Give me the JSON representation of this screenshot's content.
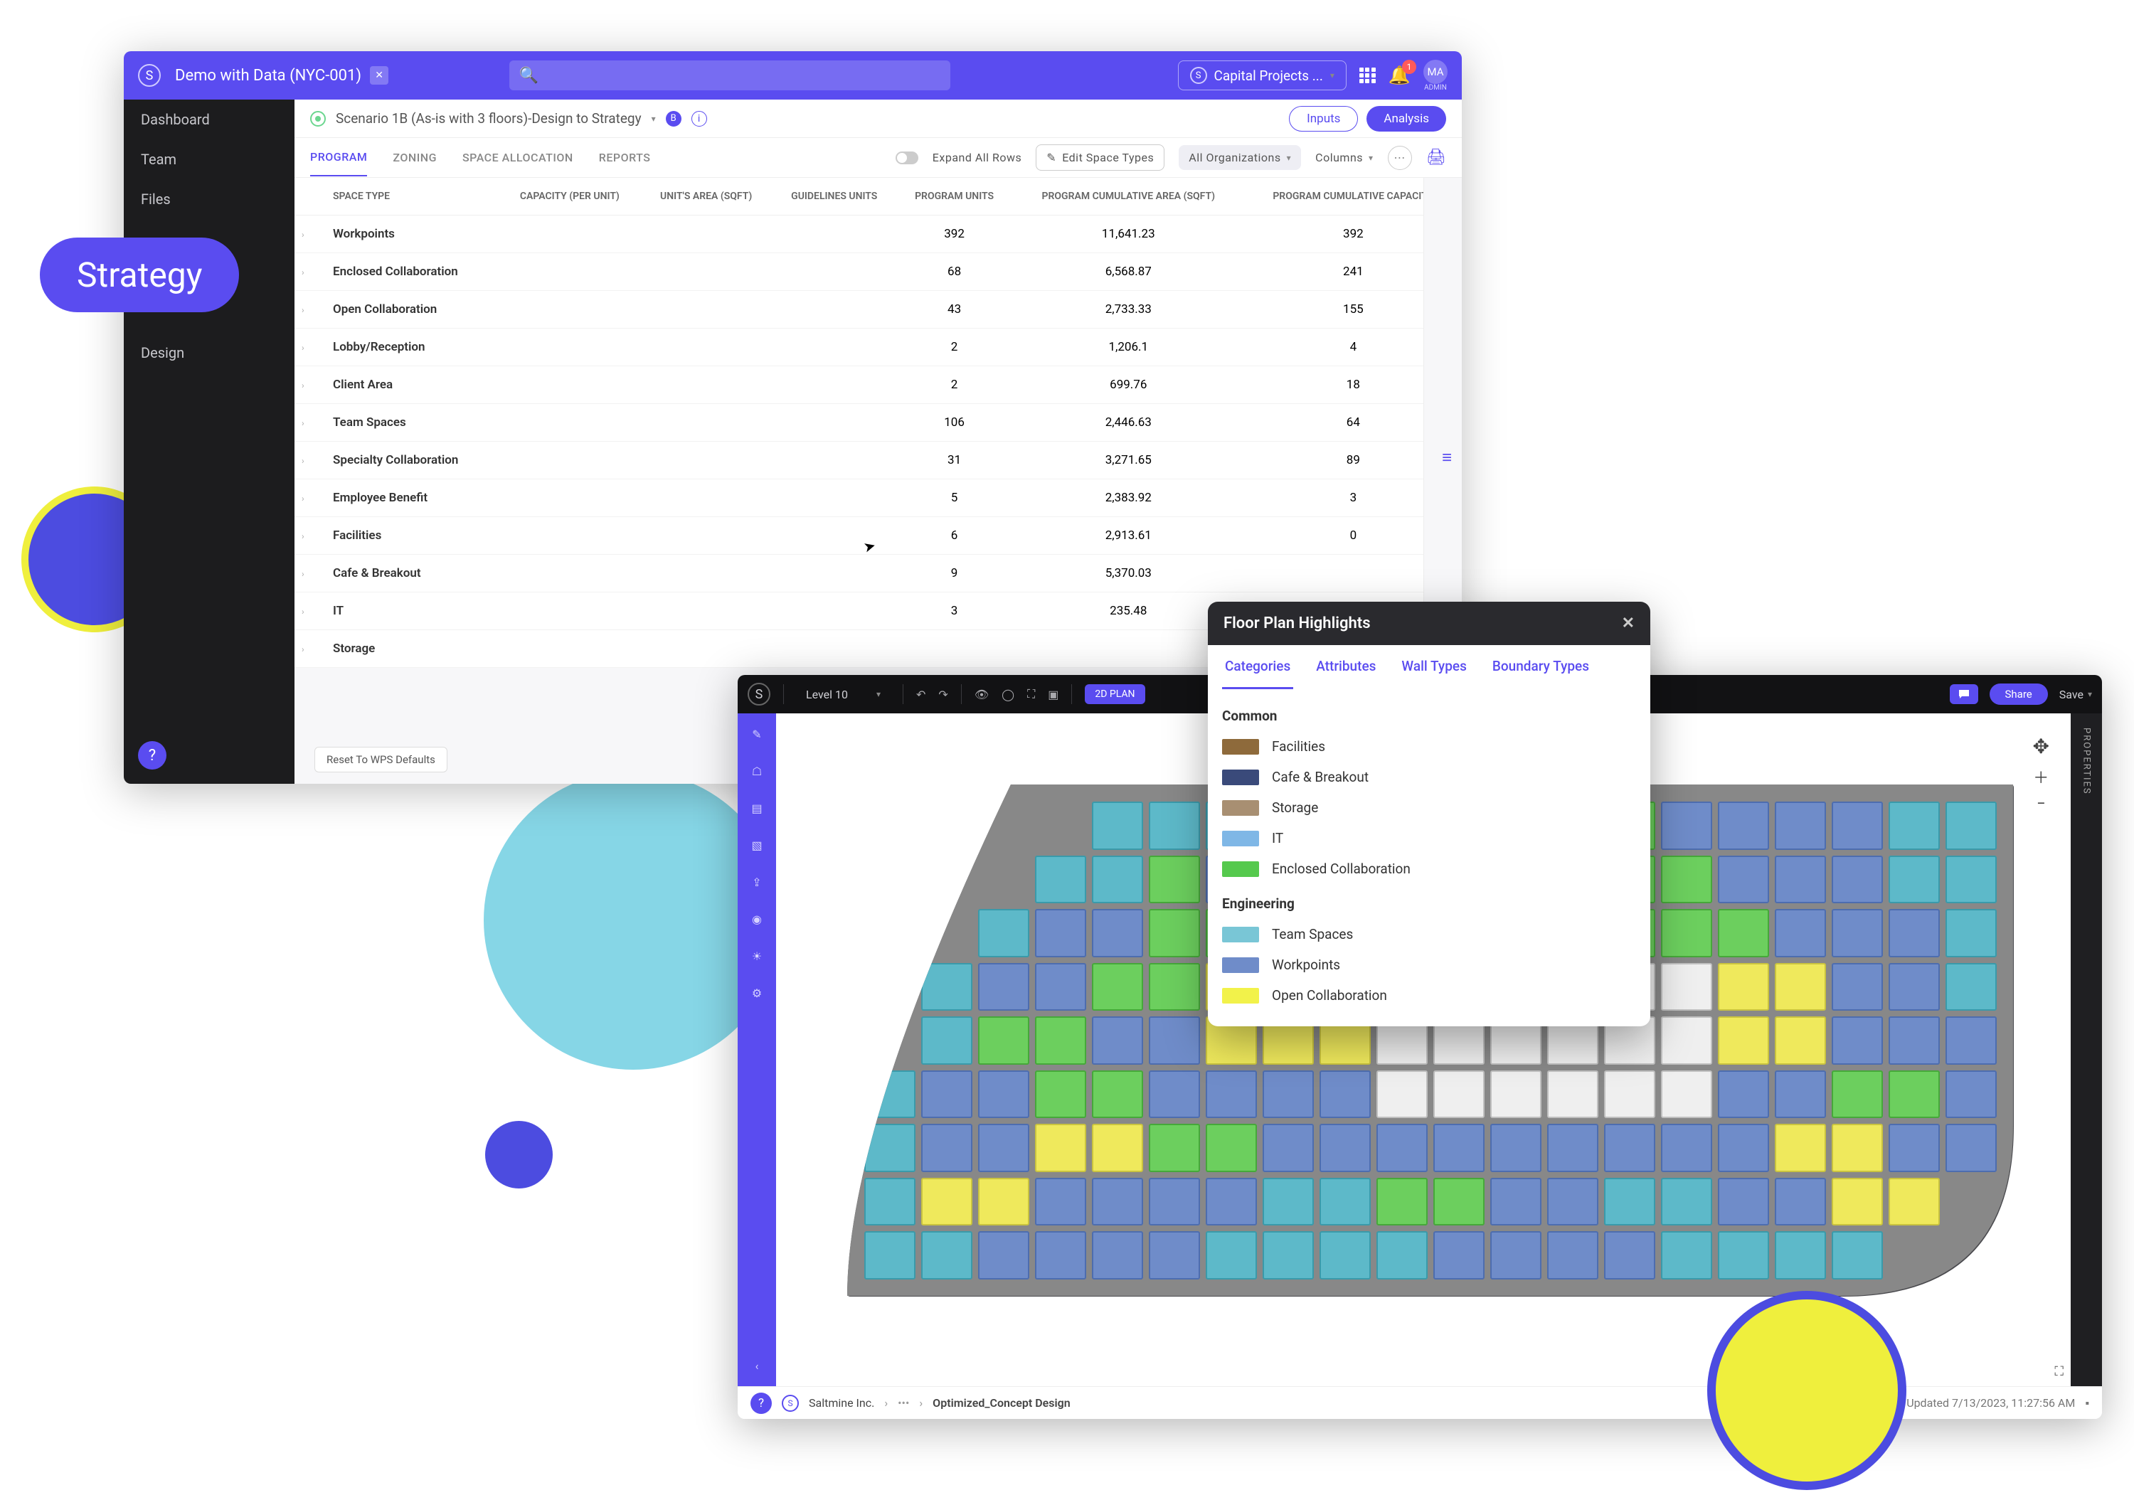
{
  "decor": {
    "strategy_pill": "Strategy"
  },
  "win1": {
    "title": "Demo with Data (NYC-001)",
    "search_placeholder": "",
    "org_selector": "Capital Projects ...",
    "notif_count": "1",
    "avatar": "MA",
    "admin_label": "ADMIN",
    "sidebar": [
      "Dashboard",
      "Team",
      "Files",
      "Design"
    ],
    "scenario": {
      "name": "Scenario 1B (As-is with 3 floors)-Design to Strategy",
      "badge": "B",
      "inputs_btn": "Inputs",
      "analysis_btn": "Analysis"
    },
    "tabs": [
      "PROGRAM",
      "ZONING",
      "SPACE ALLOCATION",
      "REPORTS"
    ],
    "tabs_right": {
      "expand": "Expand All Rows",
      "edit": "Edit Space Types",
      "filter": "All Organizations",
      "columns": "Columns"
    },
    "columns": [
      "SPACE TYPE",
      "CAPACITY (PER UNIT)",
      "UNIT'S AREA (SQFT)",
      "GUIDELINES UNITS",
      "PROGRAM UNITS",
      "PROGRAM CUMULATIVE AREA (SQFT)",
      "PROGRAM CUMULATIVE CAPACITY"
    ],
    "rows": [
      {
        "name": "Workpoints",
        "units": "392",
        "area": "11,641.23",
        "cap": "392"
      },
      {
        "name": "Enclosed Collaboration",
        "units": "68",
        "area": "6,568.87",
        "cap": "241"
      },
      {
        "name": "Open Collaboration",
        "units": "43",
        "area": "2,733.33",
        "cap": "155"
      },
      {
        "name": "Lobby/Reception",
        "units": "2",
        "area": "1,206.1",
        "cap": "4"
      },
      {
        "name": "Client Area",
        "units": "2",
        "area": "699.76",
        "cap": "18"
      },
      {
        "name": "Team Spaces",
        "units": "106",
        "area": "2,446.63",
        "cap": "64"
      },
      {
        "name": "Specialty Collaboration",
        "units": "31",
        "area": "3,271.65",
        "cap": "89"
      },
      {
        "name": "Employee Benefit",
        "units": "5",
        "area": "2,383.92",
        "cap": "3"
      },
      {
        "name": "Facilities",
        "units": "6",
        "area": "2,913.61",
        "cap": "0"
      },
      {
        "name": "Cafe & Breakout",
        "units": "9",
        "area": "5,370.03",
        "cap": ""
      },
      {
        "name": "IT",
        "units": "3",
        "area": "235.48",
        "cap": ""
      },
      {
        "name": "Storage",
        "units": "",
        "area": "",
        "cap": ""
      }
    ],
    "reset_btn": "Reset To WPS Defaults"
  },
  "win2": {
    "level": "Level 10",
    "plan_toggle": "2D PLAN",
    "share": "Share",
    "save": "Save",
    "breadcrumb": {
      "org": "Saltmine Inc.",
      "doc": "Optimized_Concept Design"
    },
    "updated": "Updated 7/13/2023, 11:27:56 AM",
    "props_label": "PROPERTIES"
  },
  "popover": {
    "title": "Floor Plan Highlights",
    "tabs": [
      "Categories",
      "Attributes",
      "Wall Types",
      "Boundary Types"
    ],
    "sections": [
      {
        "title": "Common",
        "items": [
          {
            "color": "#8e6a3b",
            "label": "Facilities"
          },
          {
            "color": "#3a4a7a",
            "label": "Cafe & Breakout"
          },
          {
            "color": "#a88f72",
            "label": "Storage"
          },
          {
            "color": "#7fb7e6",
            "label": "IT"
          },
          {
            "color": "#55c94d",
            "label": "Enclosed Collaboration"
          }
        ]
      },
      {
        "title": "Engineering",
        "items": [
          {
            "color": "#79c6d6",
            "label": "Team Spaces"
          },
          {
            "color": "#6f8cc9",
            "label": "Workpoints"
          },
          {
            "color": "#f2f24a",
            "label": "Open Collaboration"
          }
        ]
      }
    ]
  }
}
